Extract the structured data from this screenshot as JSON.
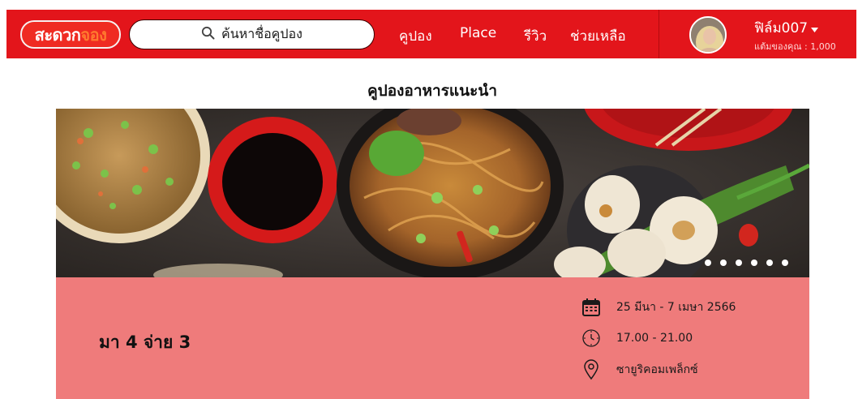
{
  "header": {
    "logo_part1": "สะดวก",
    "logo_part2": "จอง",
    "search_placeholder": "ค้นหาชื่อคูปอง",
    "menu": [
      "คูปอง",
      "Place",
      "รีวิว",
      "ช่วยเหลือ"
    ],
    "user_name": "ฟิล์ม007",
    "points_text": "แต้มของคุณ : 1,000"
  },
  "main": {
    "section_title": "คูปองอาหารแนะนำ",
    "carousel": {
      "slide_count": 6
    },
    "promo": {
      "title": "มา 4 จ่าย 3",
      "date_range": "25 มีนา - 7 เมษา 2566",
      "time_range": "17.00 - 21.00",
      "location": "ซายูริคอมเพล็กซ์"
    }
  },
  "colors": {
    "brand_red": "#e3151b",
    "promo_pink": "#ef7b7b",
    "logo_orange": "#ff7a2e"
  }
}
